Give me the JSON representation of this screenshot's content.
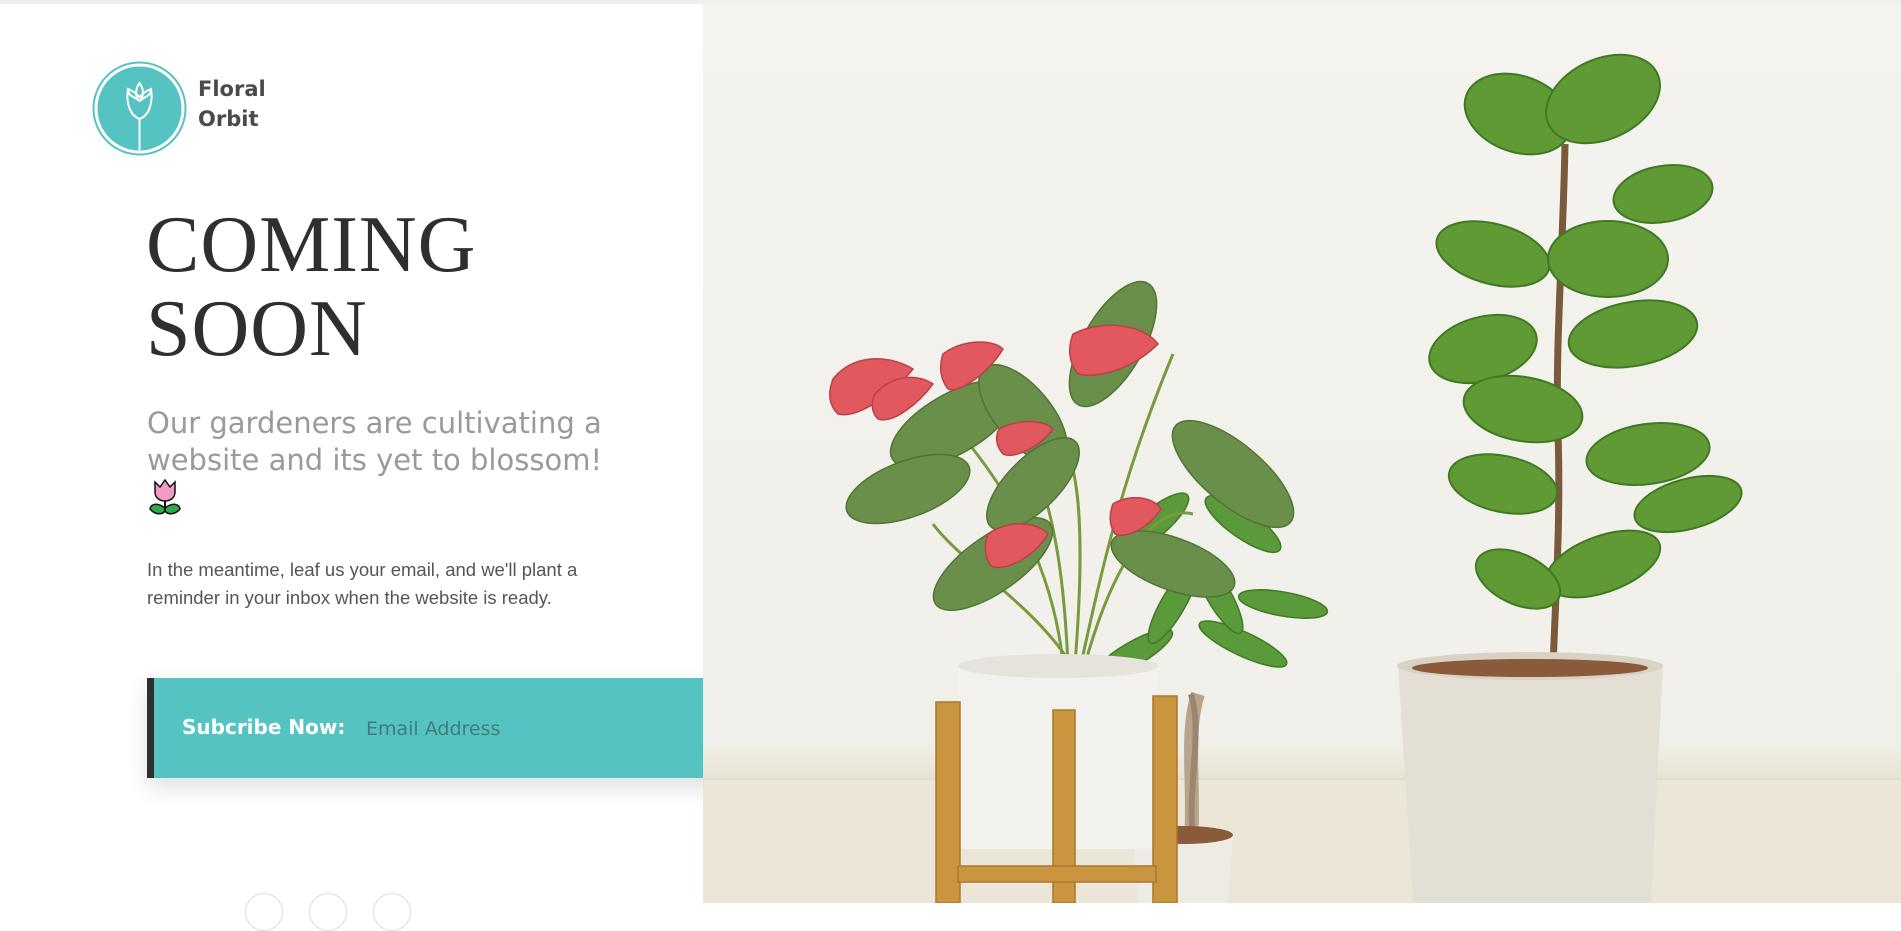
{
  "brand": {
    "name_line1": "Floral",
    "name_line2": "Orbit",
    "logo_icon": "tulip-icon",
    "accent_color": "#55c3c2"
  },
  "headline": {
    "line1": "COMING",
    "line2": "SOON"
  },
  "subhead": {
    "text": "Our gardeners are cultivating a website and its yet to blossom!",
    "emoji": "tulip-emoji"
  },
  "blurb": "In the meantime, leaf us your email, and we'll plant a reminder in your inbox when the website is ready.",
  "subscribe": {
    "label": "Subcribe Now:",
    "email_placeholder": "Email Address",
    "email_value": "",
    "submit_icon": "arrow-right-icon"
  },
  "socials": {
    "icons": [
      "social-icon-1",
      "social-icon-2",
      "social-icon-3"
    ]
  },
  "hero_image": {
    "subject": "potted plants: anthurium on wooden stand, money tree, fiddle leaf fig"
  }
}
